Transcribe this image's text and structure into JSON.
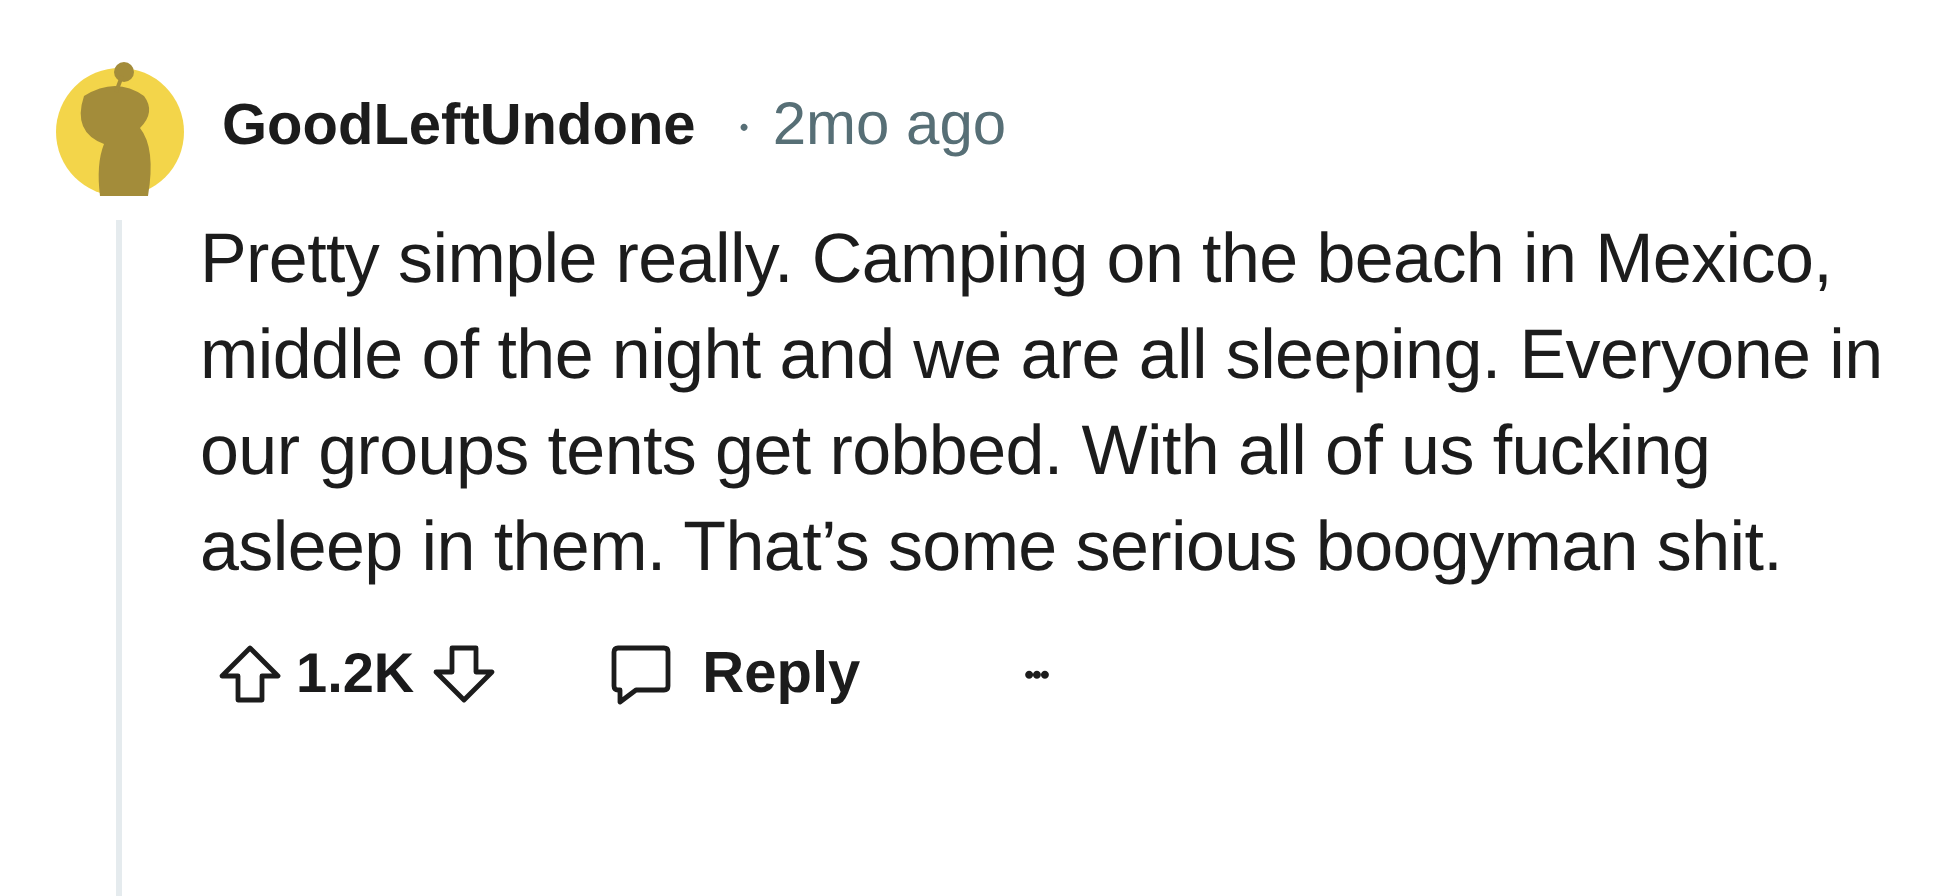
{
  "comment": {
    "author": "GoodLeftUndone",
    "separator": "•",
    "time": "2mo ago",
    "body": "Pretty simple really. Camping on the beach in Mexico, middle of the night and we are all sleeping. Everyone in our groups tents get robbed. With all of us fucking asleep in them. That’s some serious boogyman shit.",
    "score": "1.2K",
    "reply_label": "Reply",
    "more": "•••"
  }
}
